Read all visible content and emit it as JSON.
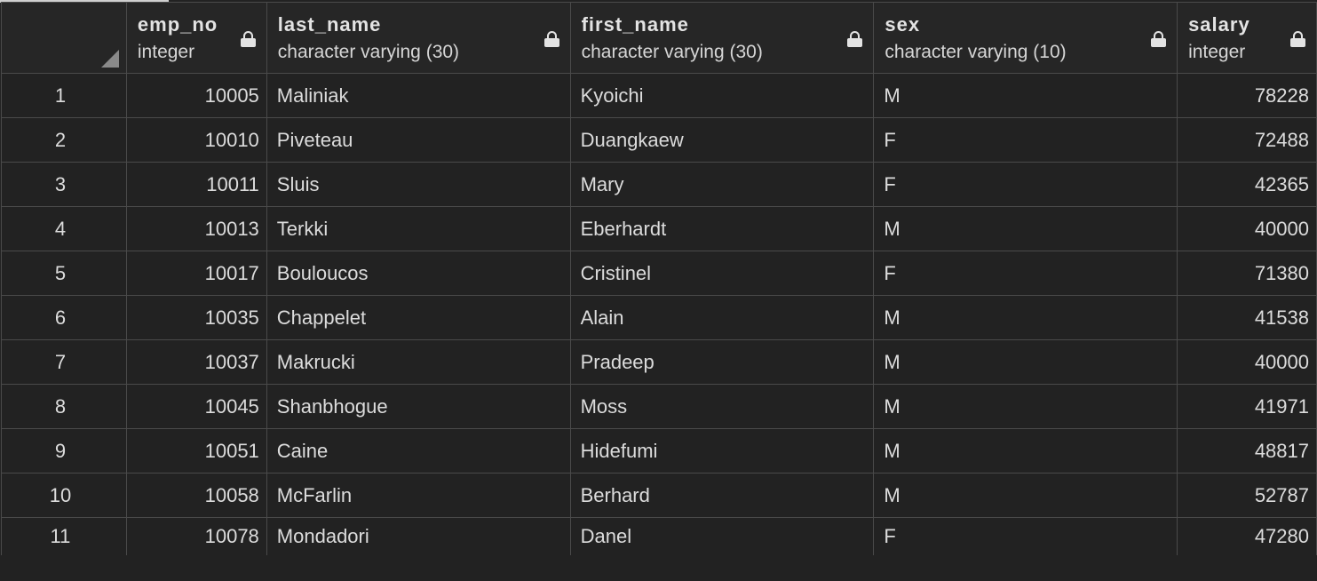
{
  "columns": [
    {
      "name": "emp_no",
      "type": "integer",
      "align": "right"
    },
    {
      "name": "last_name",
      "type": "character varying (30)",
      "align": "left"
    },
    {
      "name": "first_name",
      "type": "character varying (30)",
      "align": "left"
    },
    {
      "name": "sex",
      "type": "character varying (10)",
      "align": "left"
    },
    {
      "name": "salary",
      "type": "integer",
      "align": "right"
    }
  ],
  "rows": [
    {
      "n": "1",
      "emp_no": "10005",
      "last_name": "Maliniak",
      "first_name": "Kyoichi",
      "sex": "M",
      "salary": "78228"
    },
    {
      "n": "2",
      "emp_no": "10010",
      "last_name": "Piveteau",
      "first_name": "Duangkaew",
      "sex": "F",
      "salary": "72488"
    },
    {
      "n": "3",
      "emp_no": "10011",
      "last_name": "Sluis",
      "first_name": "Mary",
      "sex": "F",
      "salary": "42365"
    },
    {
      "n": "4",
      "emp_no": "10013",
      "last_name": "Terkki",
      "first_name": "Eberhardt",
      "sex": "M",
      "salary": "40000"
    },
    {
      "n": "5",
      "emp_no": "10017",
      "last_name": "Bouloucos",
      "first_name": "Cristinel",
      "sex": "F",
      "salary": "71380"
    },
    {
      "n": "6",
      "emp_no": "10035",
      "last_name": "Chappelet",
      "first_name": "Alain",
      "sex": "M",
      "salary": "41538"
    },
    {
      "n": "7",
      "emp_no": "10037",
      "last_name": "Makrucki",
      "first_name": "Pradeep",
      "sex": "M",
      "salary": "40000"
    },
    {
      "n": "8",
      "emp_no": "10045",
      "last_name": "Shanbhogue",
      "first_name": "Moss",
      "sex": "M",
      "salary": "41971"
    },
    {
      "n": "9",
      "emp_no": "10051",
      "last_name": "Caine",
      "first_name": "Hidefumi",
      "sex": "M",
      "salary": "48817"
    },
    {
      "n": "10",
      "emp_no": "10058",
      "last_name": "McFarlin",
      "first_name": "Berhard",
      "sex": "M",
      "salary": "52787"
    },
    {
      "n": "11",
      "emp_no": "10078",
      "last_name": "Mondadori",
      "first_name": "Danel",
      "sex": "F",
      "salary": "47280"
    }
  ],
  "icons": {
    "column_lock": "lock-icon",
    "select_all": "select-all-corner-icon"
  },
  "colors": {
    "background": "#222222",
    "grid_line": "#4a4a4a",
    "text": "#dcdcdc"
  }
}
